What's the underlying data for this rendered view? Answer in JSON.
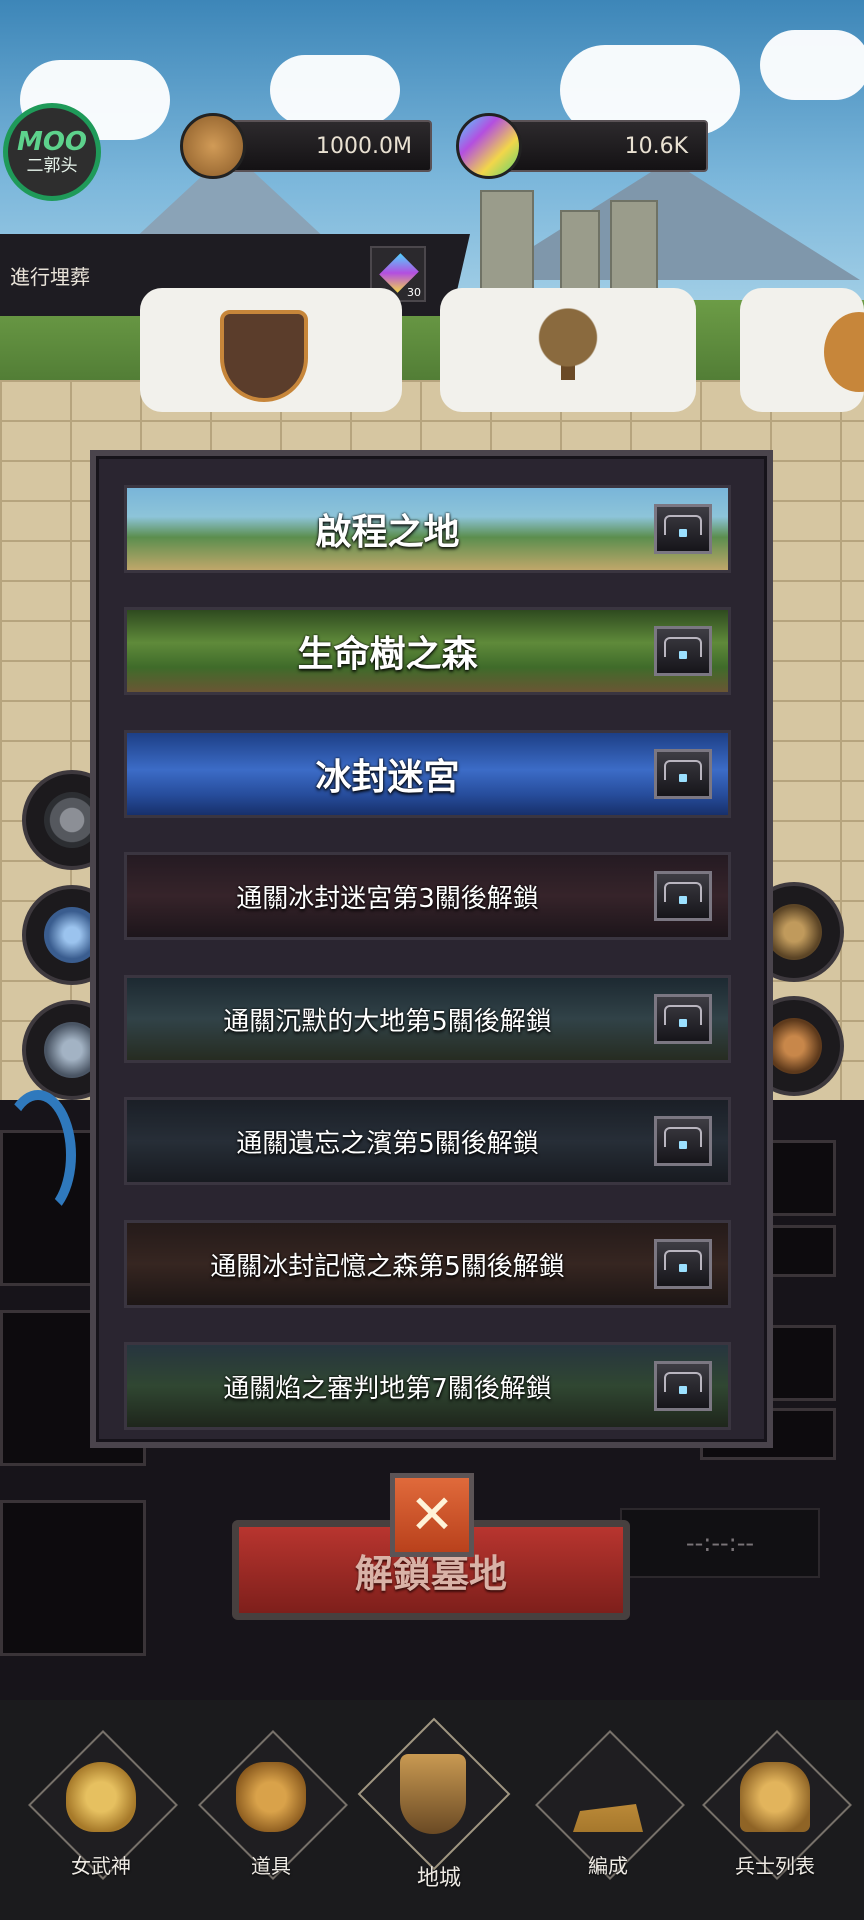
{
  "hud": {
    "logo_line1": "MOO",
    "logo_line2": "二郭头",
    "gold_value": "1000.0M",
    "gem_value": "10.6K",
    "burial_label": "進行埋葬",
    "burial_gem_count": "30"
  },
  "stages": [
    {
      "title": "啟程之地",
      "locked": false
    },
    {
      "title": "生命樹之森",
      "locked": false
    },
    {
      "title": "冰封迷宮",
      "locked": false
    },
    {
      "title": "通關冰封迷宮第3關後解鎖",
      "locked": true
    },
    {
      "title": "通關沉默的大地第5關後解鎖",
      "locked": true
    },
    {
      "title": "通關遺忘之濱第5關後解鎖",
      "locked": true
    },
    {
      "title": "通關冰封記憶之森第5關後解鎖",
      "locked": true
    },
    {
      "title": "通關焰之審判地第7關後解鎖",
      "locked": true
    }
  ],
  "unlock_button": "解鎖墓地",
  "close_icon": "close-icon",
  "timer_text": "--:--:--",
  "nav": [
    {
      "label": "女武神",
      "icon": "valkyrie-helmet-icon"
    },
    {
      "label": "道具",
      "icon": "item-bag-icon"
    },
    {
      "label": "地城",
      "icon": "dungeon-shield-icon",
      "selected": true
    },
    {
      "label": "編成",
      "icon": "formation-icon"
    },
    {
      "label": "兵士列表",
      "icon": "soldier-list-icon"
    }
  ],
  "colors": {
    "modal_bg": "#2a2530",
    "unlock_red": "#b8352f",
    "close_orange": "#e06a3b",
    "logo_green": "#1f9a59"
  }
}
